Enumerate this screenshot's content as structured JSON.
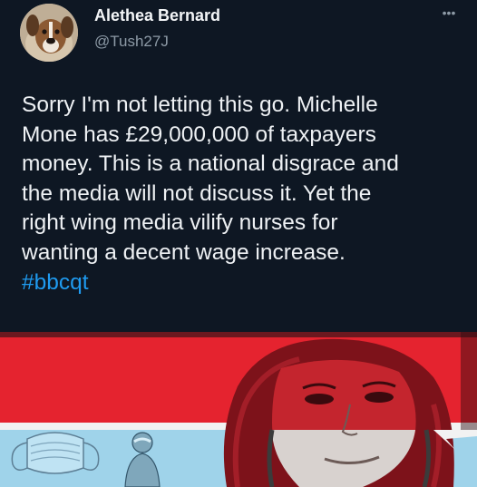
{
  "user": {
    "display_name": "Alethea Bernard",
    "handle": "@Tush27J"
  },
  "more_icon": "•••",
  "tweet": {
    "lines": [
      "Sorry I'm not letting this go. Michelle",
      "Mone has £29,000,000 of taxpayers",
      "money. This is a national disgrace and",
      "the media will not discuss it. Yet the",
      "right wing media vilify nurses for",
      "wanting a decent wage increase."
    ],
    "hashtag": "#bbcqt"
  },
  "colors": {
    "background": "#0e1723",
    "text": "#eef1f4",
    "handle": "#8d9aa6",
    "link": "#1f9bf0",
    "media_red": "#e5232f",
    "media_blue": "#9fd3ea"
  },
  "icons": {
    "avatar": "dog-photo-avatar",
    "more": "more-options-icon",
    "media": "collage-image"
  }
}
